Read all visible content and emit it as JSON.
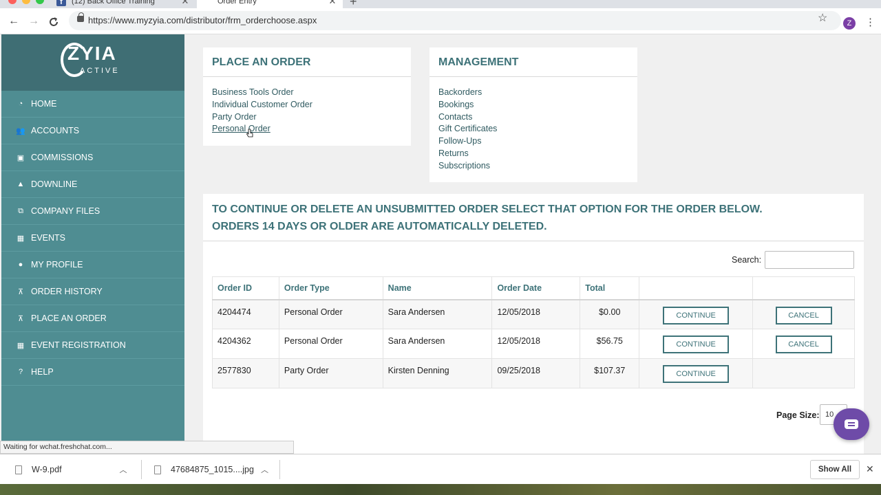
{
  "browser": {
    "tabs": [
      {
        "title": "(12) Back Office Training",
        "active": false
      },
      {
        "title": "Order Entry",
        "active": true
      }
    ],
    "url": "https://www.myzyia.com/distributor/frm_orderchoose.aspx",
    "profile_initial": "Z"
  },
  "sidebar": {
    "logo": {
      "word": "ZYIA",
      "sub": "ACTIVE"
    },
    "items": [
      {
        "label": "HOME",
        "icon": "dashboard-icon"
      },
      {
        "label": "ACCOUNTS",
        "icon": "users-icon"
      },
      {
        "label": "COMMISSIONS",
        "icon": "money-icon"
      },
      {
        "label": "DOWNLINE",
        "icon": "area-chart-icon"
      },
      {
        "label": "COMPANY FILES",
        "icon": "files-icon"
      },
      {
        "label": "EVENTS",
        "icon": "calendar-icon"
      },
      {
        "label": "MY PROFILE",
        "icon": "user-icon"
      },
      {
        "label": "ORDER HISTORY",
        "icon": "cart-icon"
      },
      {
        "label": "PLACE AN ORDER",
        "icon": "cart-icon"
      },
      {
        "label": "EVENT REGISTRATION",
        "icon": "calendar-icon"
      },
      {
        "label": "HELP",
        "icon": "help-icon"
      }
    ]
  },
  "place_order": {
    "title": "PLACE AN ORDER",
    "links": [
      "Business Tools Order",
      "Individual Customer Order",
      "Party Order",
      "Personal Order"
    ]
  },
  "management": {
    "title": "MANAGEMENT",
    "links": [
      "Backorders",
      "Bookings",
      "Contacts",
      "Gift Certificates",
      "Follow-Ups",
      "Returns",
      "Subscriptions"
    ]
  },
  "unsubmitted": {
    "heading_line1": "TO CONTINUE OR DELETE AN UNSUBMITTED ORDER SELECT THAT OPTION FOR THE ORDER BELOW.",
    "heading_line2": "ORDERS 14 DAYS OR OLDER ARE AUTOMATICALLY DELETED.",
    "search_label": "Search:",
    "search_value": "",
    "columns": [
      "Order ID",
      "Order Type",
      "Name",
      "Order Date",
      "Total"
    ],
    "rows": [
      {
        "id": "4204474",
        "type": "Personal Order",
        "name": "Sara Andersen",
        "date": "12/05/2018",
        "total": "$0.00",
        "continue": "CONTINUE",
        "cancel": "CANCEL"
      },
      {
        "id": "4204362",
        "type": "Personal Order",
        "name": "Sara Andersen",
        "date": "12/05/2018",
        "total": "$56.75",
        "continue": "CONTINUE",
        "cancel": "CANCEL"
      },
      {
        "id": "2577830",
        "type": "Party Order",
        "name": "Kirsten Denning",
        "date": "09/25/2018",
        "total": "$107.37",
        "continue": "CONTINUE",
        "cancel": ""
      }
    ],
    "page_size_label": "Page Size:",
    "page_size_value": "10"
  },
  "status_text": "Waiting for wchat.freshchat.com...",
  "downloads": {
    "files": [
      "W-9.pdf",
      "47684875_1015....jpg"
    ],
    "show_all": "Show All"
  }
}
